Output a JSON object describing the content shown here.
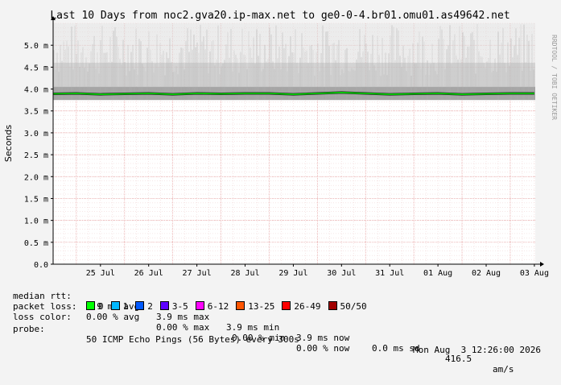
{
  "chart_data": {
    "type": "line",
    "title": "Last 10 Days from noc2.gva20.ip-max.net to ge0-0-4.br01.omu01.as49642.net",
    "ylabel": "Seconds",
    "xlabel": "",
    "watermark": "RRDTOOL / TOBI OETIKER",
    "ylim": [
      0,
      5.5
    ],
    "y_ticks": [
      "0.0",
      "0.5 m",
      "1.0 m",
      "1.5 m",
      "2.0 m",
      "2.5 m",
      "3.0 m",
      "3.5 m",
      "4.0 m",
      "4.5 m",
      "5.0 m"
    ],
    "x_ticks": [
      "25 Jul",
      "26 Jul",
      "27 Jul",
      "28 Jul",
      "29 Jul",
      "30 Jul",
      "31 Jul",
      "01 Aug",
      "02 Aug",
      "03 Aug"
    ],
    "grid": true,
    "series": [
      {
        "name": "median rtt",
        "color": "#00e000",
        "x": [
          "24 Jul 12:00",
          "25 Jul 00:00",
          "25 Jul 12:00",
          "26 Jul 00:00",
          "26 Jul 12:00",
          "27 Jul 00:00",
          "27 Jul 12:00",
          "28 Jul 00:00",
          "28 Jul 12:00",
          "29 Jul 00:00",
          "29 Jul 12:00",
          "30 Jul 00:00",
          "30 Jul 12:00",
          "31 Jul 00:00",
          "31 Jul 12:00",
          "01 Aug 00:00",
          "01 Aug 12:00",
          "02 Aug 00:00",
          "02 Aug 12:00",
          "03 Aug 00:00",
          "03 Aug 12:00"
        ],
        "values": [
          3.89,
          3.9,
          3.88,
          3.89,
          3.9,
          3.88,
          3.9,
          3.89,
          3.9,
          3.9,
          3.88,
          3.9,
          3.92,
          3.9,
          3.88,
          3.89,
          3.9,
          3.88,
          3.89,
          3.9,
          3.9
        ]
      }
    ],
    "smoke_band": {
      "min_values_ms": [
        3.75,
        3.8
      ],
      "max_values_ms": [
        5.5,
        5.5
      ]
    }
  },
  "stats": {
    "median_rtt": {
      "label": "median rtt:",
      "avg": "3.9 ms avg",
      "max": "3.9 ms max",
      "min": "3.9 ms min",
      "now": "3.9 ms now",
      "sd": "0.0 ms sd",
      "am": "416.5",
      "am_unit": "am/s"
    },
    "packet_loss": {
      "label": "packet loss:",
      "avg": "0.00 % avg",
      "max": "0.00 % max",
      "min": "0.00 % min",
      "now": "0.00 % now"
    },
    "loss_color": {
      "label": "loss color:",
      "items": [
        {
          "label": "0",
          "color": "#00ff00"
        },
        {
          "label": "1",
          "color": "#00b8ff"
        },
        {
          "label": "2",
          "color": "#0059ff"
        },
        {
          "label": "3-5",
          "color": "#5e00ff"
        },
        {
          "label": "6-12",
          "color": "#ff00ff"
        },
        {
          "label": "13-25",
          "color": "#ff5500"
        },
        {
          "label": "26-49",
          "color": "#ff0000"
        },
        {
          "label": "50/50",
          "color": "#a10000"
        }
      ]
    },
    "probe": {
      "label": "probe:",
      "text": "50 ICMP Echo Pings (56 Bytes) every 300s",
      "timestamp": "Mon Aug  3 12:26:00 2026"
    }
  }
}
